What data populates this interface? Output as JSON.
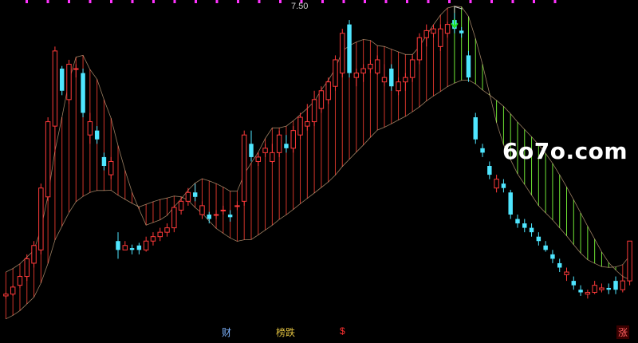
{
  "colors": {
    "background": "#000000",
    "up_candle": "#ff3a3a",
    "down_candle": "#4fe6ff",
    "band_red": "#e63a2e",
    "band_green": "#7cff3a",
    "marker_arrow": "#22dd22",
    "top_ticks": "#ff33ff"
  },
  "watermark": "6o7o.com",
  "bottom_markers": {
    "cai": "财",
    "bang": "榜跌",
    "s": "$",
    "zhang": "涨"
  },
  "chart_data": {
    "type": "candlestick",
    "peak_label": "7.50",
    "ylim": [
      4.1,
      7.6
    ],
    "candles": [
      [
        4.38,
        4.42,
        4.35,
        4.4
      ],
      [
        4.4,
        4.5,
        4.38,
        4.48
      ],
      [
        4.5,
        4.62,
        4.47,
        4.6
      ],
      [
        4.6,
        4.85,
        4.55,
        4.8
      ],
      [
        4.75,
        5.0,
        4.7,
        4.95
      ],
      [
        4.9,
        5.65,
        4.85,
        5.6
      ],
      [
        5.5,
        6.4,
        5.45,
        6.35
      ],
      [
        6.3,
        7.2,
        6.0,
        7.15
      ],
      [
        6.95,
        6.98,
        6.65,
        6.7
      ],
      [
        6.6,
        7.05,
        6.55,
        7.0
      ],
      [
        6.95,
        7.0,
        6.85,
        6.95
      ],
      [
        6.9,
        6.95,
        6.4,
        6.45
      ],
      [
        6.2,
        6.45,
        6.1,
        6.35
      ],
      [
        6.25,
        6.3,
        6.1,
        6.15
      ],
      [
        5.95,
        6.0,
        5.8,
        5.85
      ],
      [
        5.75,
        5.95,
        5.7,
        5.9
      ],
      [
        5.0,
        5.1,
        4.8,
        4.9
      ],
      [
        4.9,
        5.0,
        4.9,
        4.95
      ],
      [
        4.92,
        4.96,
        4.85,
        4.9
      ],
      [
        4.95,
        4.98,
        4.85,
        4.9
      ],
      [
        4.9,
        5.05,
        4.88,
        5.0
      ],
      [
        5.0,
        5.1,
        4.95,
        5.05
      ],
      [
        5.05,
        5.15,
        5.0,
        5.1
      ],
      [
        5.1,
        5.2,
        5.05,
        5.15
      ],
      [
        5.15,
        5.4,
        5.1,
        5.38
      ],
      [
        5.35,
        5.5,
        5.3,
        5.45
      ],
      [
        5.45,
        5.6,
        5.4,
        5.55
      ],
      [
        5.55,
        5.65,
        5.45,
        5.5
      ],
      [
        5.3,
        5.45,
        5.25,
        5.4
      ],
      [
        5.3,
        5.33,
        5.2,
        5.25
      ],
      [
        5.3,
        5.35,
        5.25,
        5.3
      ],
      [
        5.35,
        5.4,
        5.3,
        5.35
      ],
      [
        5.3,
        5.35,
        5.22,
        5.27
      ],
      [
        5.4,
        5.45,
        5.35,
        5.4
      ],
      [
        5.45,
        6.25,
        5.4,
        6.2
      ],
      [
        6.1,
        6.25,
        5.9,
        5.95
      ],
      [
        5.9,
        6.0,
        5.85,
        5.95
      ],
      [
        6.0,
        6.1,
        5.95,
        6.05
      ],
      [
        5.9,
        6.1,
        5.88,
        6.0
      ],
      [
        6.0,
        6.25,
        5.95,
        6.2
      ],
      [
        6.1,
        6.2,
        6.0,
        6.05
      ],
      [
        6.05,
        6.3,
        6.0,
        6.25
      ],
      [
        6.2,
        6.45,
        6.15,
        6.4
      ],
      [
        6.3,
        6.55,
        6.25,
        6.35
      ],
      [
        6.35,
        6.7,
        6.3,
        6.6
      ],
      [
        6.5,
        6.75,
        6.45,
        6.7
      ],
      [
        6.6,
        6.85,
        6.55,
        6.8
      ],
      [
        6.75,
        7.1,
        6.7,
        7.05
      ],
      [
        6.9,
        7.4,
        6.85,
        7.35
      ],
      [
        7.45,
        7.5,
        6.85,
        6.9
      ],
      [
        6.85,
        6.95,
        6.75,
        6.9
      ],
      [
        6.9,
        7.0,
        6.8,
        6.95
      ],
      [
        6.95,
        7.05,
        6.9,
        7.0
      ],
      [
        6.9,
        7.1,
        6.88,
        7.05
      ],
      [
        6.8,
        7.0,
        6.75,
        6.85
      ],
      [
        6.95,
        7.0,
        6.7,
        6.75
      ],
      [
        6.7,
        6.85,
        6.65,
        6.8
      ],
      [
        6.8,
        6.9,
        6.7,
        6.85
      ],
      [
        6.85,
        7.1,
        6.8,
        7.05
      ],
      [
        7.05,
        7.35,
        7.0,
        7.3
      ],
      [
        7.3,
        7.45,
        7.2,
        7.38
      ],
      [
        7.35,
        7.45,
        7.3,
        7.4
      ],
      [
        7.2,
        7.45,
        7.15,
        7.4
      ],
      [
        7.35,
        7.48,
        7.3,
        7.45
      ],
      [
        7.5,
        7.58,
        7.35,
        7.4
      ],
      [
        7.38,
        7.42,
        7.3,
        7.35
      ],
      [
        7.1,
        7.15,
        6.8,
        6.85
      ],
      [
        6.4,
        6.45,
        6.1,
        6.15
      ],
      [
        6.05,
        6.1,
        5.95,
        6.0
      ],
      [
        5.85,
        5.9,
        5.7,
        5.75
      ],
      [
        5.6,
        5.75,
        5.55,
        5.7
      ],
      [
        5.65,
        5.7,
        5.55,
        5.6
      ],
      [
        5.55,
        5.58,
        5.25,
        5.3
      ],
      [
        5.25,
        5.3,
        5.15,
        5.2
      ],
      [
        5.2,
        5.25,
        5.1,
        5.15
      ],
      [
        5.15,
        5.2,
        5.05,
        5.1
      ],
      [
        5.05,
        5.1,
        4.95,
        5.0
      ],
      [
        4.95,
        5.0,
        4.88,
        4.9
      ],
      [
        4.85,
        4.9,
        4.75,
        4.8
      ],
      [
        4.75,
        4.8,
        4.65,
        4.7
      ],
      [
        4.62,
        4.7,
        4.55,
        4.65
      ],
      [
        4.55,
        4.6,
        4.45,
        4.5
      ],
      [
        4.45,
        4.5,
        4.38,
        4.42
      ],
      [
        4.4,
        4.45,
        4.35,
        4.42
      ],
      [
        4.42,
        4.55,
        4.4,
        4.5
      ],
      [
        4.45,
        4.52,
        4.42,
        4.47
      ],
      [
        4.47,
        4.52,
        4.4,
        4.45
      ],
      [
        4.55,
        4.6,
        4.4,
        4.45
      ],
      [
        4.45,
        4.6,
        4.42,
        4.55
      ],
      [
        4.55,
        5.0,
        4.5,
        5.0
      ]
    ]
  }
}
